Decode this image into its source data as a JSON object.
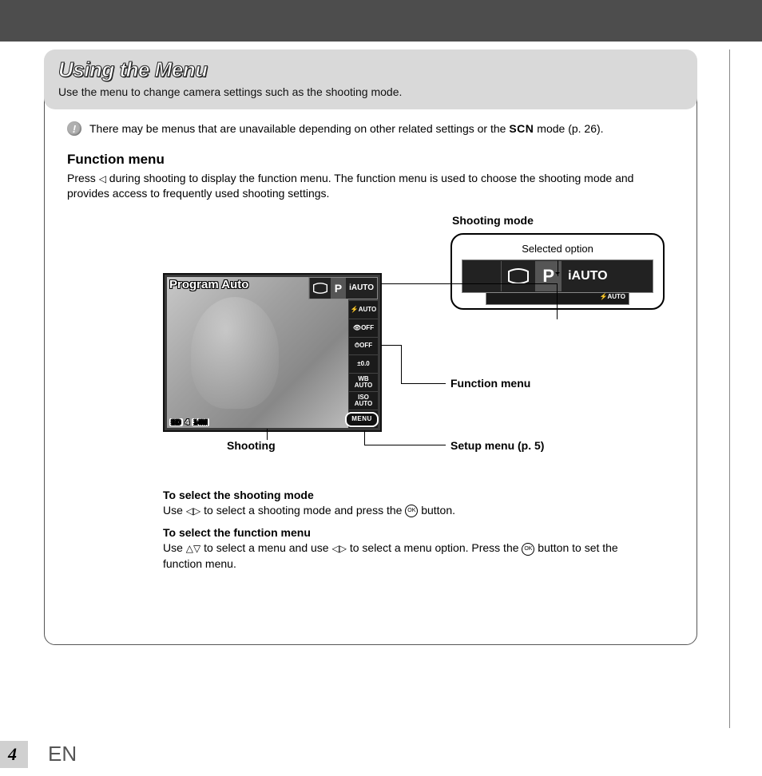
{
  "header": {
    "title": "Using the Menu",
    "subtitle": "Use the menu to change camera settings such as the shooting mode."
  },
  "note": {
    "text_before": "There may be menus that are unavailable depending on other related settings or the ",
    "scn": "SCN",
    "text_after": " mode (p. 26)."
  },
  "section": {
    "title": "Function menu",
    "para_before": "Press ",
    "para_after": " during shooting to display the function menu. The function menu is used to choose the shooting mode and provides access to frequently used shooting settings."
  },
  "lcd": {
    "title": "Program Auto",
    "mode_p": "P",
    "mode_iauto": "iAUTO",
    "side_items": [
      "⚡AUTO",
      "👁OFF",
      "⏱OFF",
      "±0.0",
      "WB\nAUTO",
      "ISO\nAUTO",
      "▭"
    ],
    "menu_label": "MENU",
    "footer_sd": "SD",
    "footer_num": "4",
    "footer_mp": "14M"
  },
  "callout": {
    "shooting_mode": "Shooting mode",
    "selected_option": "Selected option",
    "mode_p": "P",
    "mode_iauto": "iAUTO",
    "sub": "⚡AUTO"
  },
  "labels": {
    "shooting": "Shooting",
    "function_menu": "Function menu",
    "setup_menu": "Setup menu (p. 5)"
  },
  "instructions": {
    "h1": "To select the shooting mode",
    "p1a": "Use ",
    "p1b": " to select a shooting mode and press the ",
    "p1c": " button.",
    "h2": "To select the function menu",
    "p2a": "Use ",
    "p2b": " to select a menu and use ",
    "p2c": " to select a menu option. Press the ",
    "p2d": " button to set the function menu.",
    "ok": "OK"
  },
  "footer": {
    "page": "4",
    "lang": "EN"
  }
}
